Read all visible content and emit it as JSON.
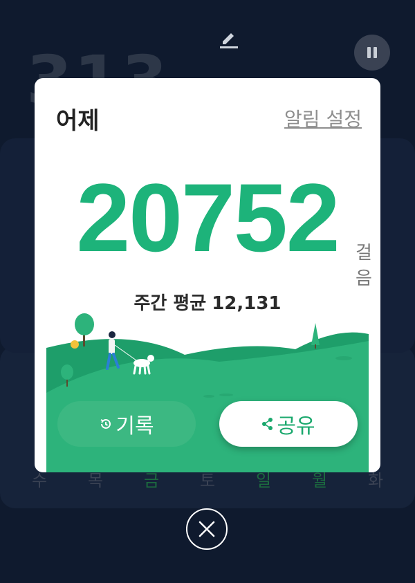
{
  "background": {
    "step_count_partial": "313",
    "day_labels": [
      {
        "label": "수",
        "active": false
      },
      {
        "label": "목",
        "active": false
      },
      {
        "label": "금",
        "active": true
      },
      {
        "label": "토",
        "active": false
      },
      {
        "label": "일",
        "active": true
      },
      {
        "label": "월",
        "active": true
      },
      {
        "label": "화",
        "active": false
      }
    ]
  },
  "modal": {
    "title": "어제",
    "alarm_link": "알림 설정",
    "steps": "20752",
    "steps_unit": "걸음",
    "weekly_label": "주간 평균",
    "weekly_value": "12,131",
    "history_label": "기록",
    "share_label": "공유"
  },
  "colors": {
    "accent": "#1db37a",
    "hill_dark": "#1e9e6a",
    "hill_light": "#2db37b",
    "background": "#0f1a2e"
  },
  "icons": {
    "edit": "pencil-icon",
    "pause": "pause-icon",
    "history": "history-icon",
    "share": "share-icon",
    "close": "close-icon"
  }
}
